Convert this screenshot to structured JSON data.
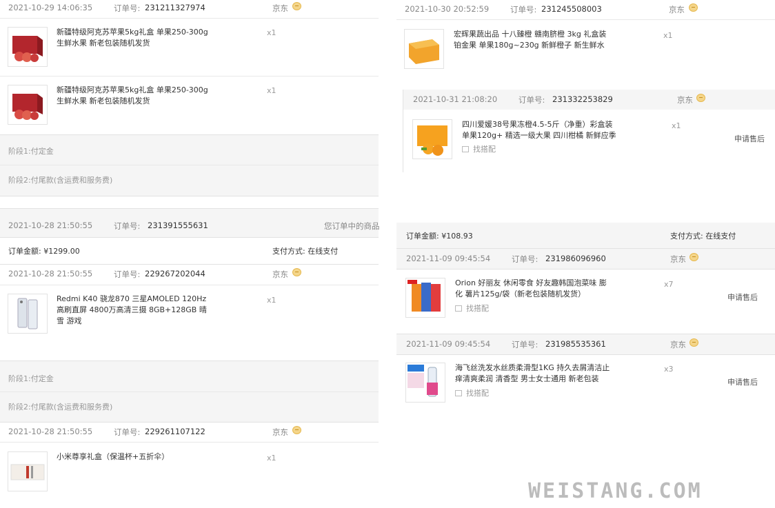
{
  "labels": {
    "order_no": "订单号:",
    "shop": "京东",
    "stage1": "阶段1:付定金",
    "stage2": "阶段2:付尾款(含运费和服务费)",
    "find_match": "找搭配",
    "after_sale": "申请售后",
    "pay_method": "支付方式: 在线支付",
    "goods_in_order": "您订单中的商品"
  },
  "left": {
    "o1": {
      "date": "2021-10-29 14:06:35",
      "no": "231211327974",
      "item1": {
        "title": "新疆特级阿克苏苹果5kg礼盒 单果250-300g 生鲜水果 新老包装随机发货",
        "qty": "x1"
      },
      "item2": {
        "title": "新疆特级阿克苏苹果5kg礼盒 单果250-300g 生鲜水果 新老包装随机发货",
        "qty": "x1"
      }
    },
    "o2": {
      "date": "2021-10-28 21:50:55",
      "no": "231391555631",
      "amount": "订单金额: ¥1299.00"
    },
    "o3": {
      "date": "2021-10-28 21:50:55",
      "no": "229267202044",
      "item": {
        "title": "Redmi K40 骁龙870 三星AMOLED 120Hz高刷直屏 4800万高清三摄 8GB+128GB 晴雪 游戏",
        "qty": "x1"
      }
    },
    "o4": {
      "date": "2021-10-28 21:50:55",
      "no": "229261107122",
      "item": {
        "title": "小米尊享礼盒（保温杯+五折伞）",
        "qty": "x1"
      }
    }
  },
  "right": {
    "o1": {
      "date": "2021-10-30 20:52:59",
      "no": "231245508003",
      "item": {
        "title": "宏辉果蔬出品 十八臻橙 赣南脐橙 3kg 礼盒装 铂金果 单果180g~230g 新鲜橙子 新生鲜水",
        "qty": "x1"
      }
    },
    "o2": {
      "date": "2021-10-31 21:08:20",
      "no": "231332253829",
      "item": {
        "title": "四川爱媛38号果冻橙4.5-5斤（净重）彩盒装 单果120g+ 精选一级大果 四川柑橘 新鲜应季",
        "qty": "x1"
      }
    },
    "summary": {
      "amount": "订单金额: ¥108.93"
    },
    "o3": {
      "date": "2021-11-09 09:45:54",
      "no": "231986096960",
      "item": {
        "title": "Orion 好丽友 休闲零食 好友趣韩国泡菜味 膨化 薯片125g/袋（新老包装随机发货）",
        "qty": "x7"
      }
    },
    "o4": {
      "date": "2021-11-09 09:45:54",
      "no": "231985535361",
      "item": {
        "title": "海飞丝洗发水丝质柔滑型1KG 持久去屑清洁止痒清爽柔润 清香型 男士女士通用 新老包装",
        "qty": "x3"
      }
    }
  },
  "watermark": "WEISTANG.COM"
}
